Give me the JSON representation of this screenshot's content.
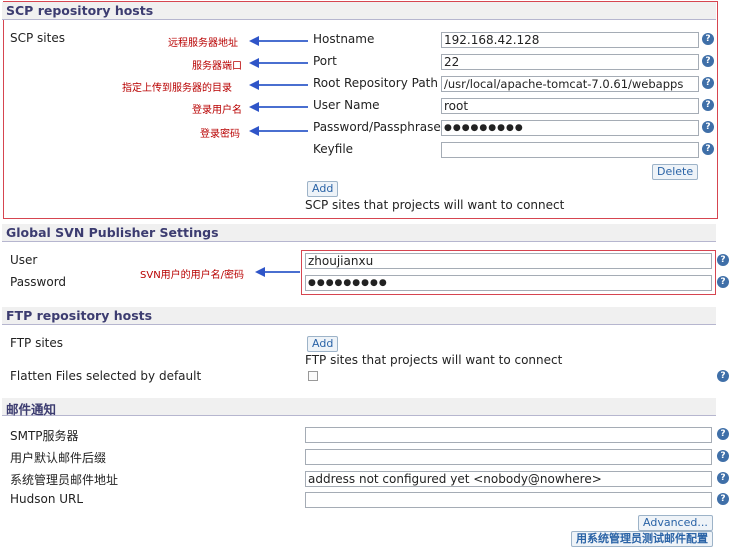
{
  "scp": {
    "title": "SCP repository hosts",
    "sites_label": "SCP sites",
    "hostname_label": "Hostname",
    "hostname_value": "192.168.42.128",
    "port_label": "Port",
    "port_value": "22",
    "root_label": "Root Repository Path",
    "root_value": "/usr/local/apache-tomcat-7.0.61/webapps",
    "user_label": "User Name",
    "user_value": "root",
    "password_label": "Password/Passphrase",
    "password_value": "●●●●●●●●●",
    "keyfile_label": "Keyfile",
    "keyfile_value": "",
    "delete_label": "Delete",
    "add_label": "Add",
    "desc": "SCP sites that projects will want to connect",
    "notes": {
      "hostname": "远程服务器地址",
      "port": "服务器端口",
      "root": "指定上传到服务器的目录",
      "user": "登录用户名",
      "password": "登录密码"
    }
  },
  "svn": {
    "title": "Global SVN Publisher Settings",
    "user_label": "User",
    "user_value": "zhoujianxu",
    "password_label": "Password",
    "password_value": "●●●●●●●●●",
    "note": "SVN用户的用户名/密码"
  },
  "ftp": {
    "title": "FTP repository hosts",
    "sites_label": "FTP sites",
    "add_label": "Add",
    "desc": "FTP sites that projects will want to connect",
    "flatten_label": "Flatten Files selected by default"
  },
  "mail": {
    "title": "邮件通知",
    "smtp_label": "SMTP服务器",
    "smtp_value": "",
    "suffix_label": "用户默认邮件后缀",
    "suffix_value": "",
    "admin_label": "系统管理员邮件地址",
    "admin_value": "address not configured yet <nobody@nowhere>",
    "hudson_label": "Hudson URL",
    "hudson_value": "",
    "advanced_label": "Advanced...",
    "test_label": "用系统管理员测试邮件配置"
  },
  "help_glyph": "?",
  "colors": {
    "accent": "#3f6fa8",
    "annotation": "#b80000",
    "highlight_box": "#d64550"
  }
}
